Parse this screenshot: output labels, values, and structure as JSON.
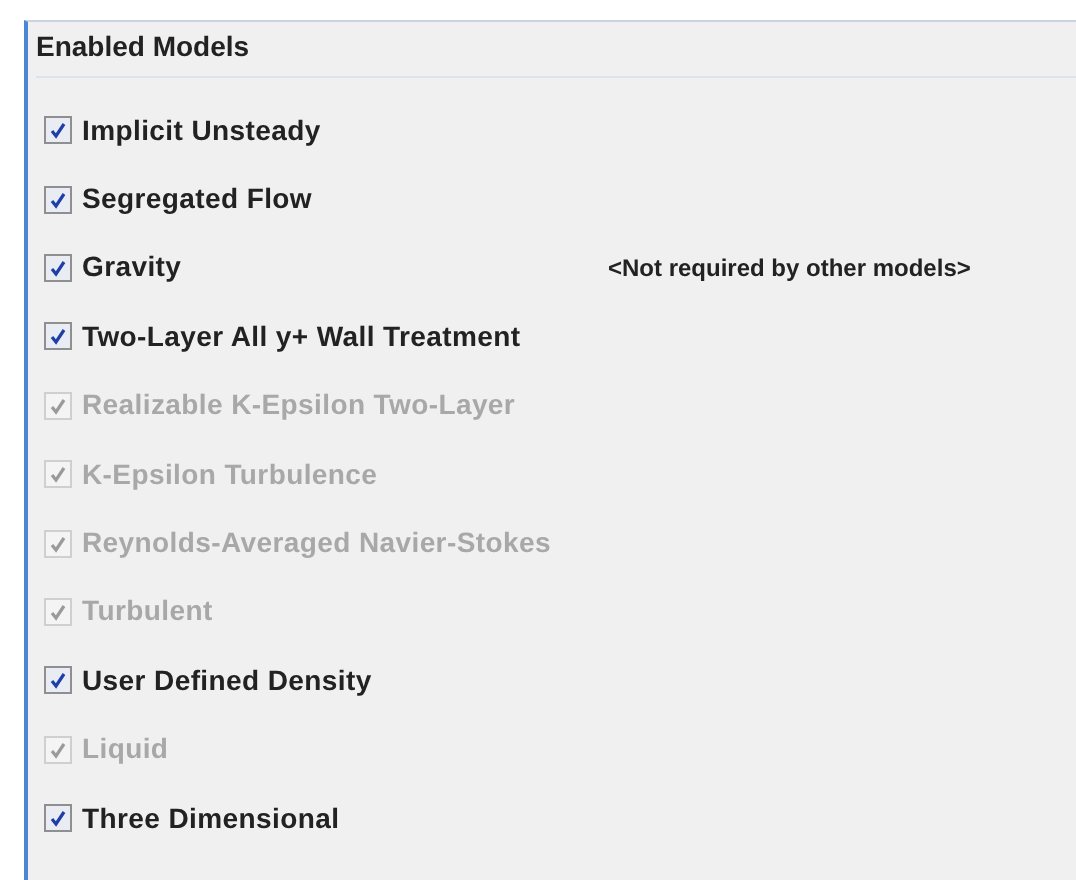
{
  "panel": {
    "title": "Enabled Models",
    "models": [
      {
        "label": "Implicit Unsteady",
        "checked": true,
        "disabled": false
      },
      {
        "label": "Segregated Flow",
        "checked": true,
        "disabled": false
      },
      {
        "label": "Gravity",
        "checked": true,
        "disabled": false,
        "note": "<Not required by other models>"
      },
      {
        "label": "Two-Layer All y+ Wall Treatment",
        "checked": true,
        "disabled": false
      },
      {
        "label": "Realizable K-Epsilon Two-Layer",
        "checked": true,
        "disabled": true
      },
      {
        "label": "K-Epsilon Turbulence",
        "checked": true,
        "disabled": true
      },
      {
        "label": "Reynolds-Averaged Navier-Stokes",
        "checked": true,
        "disabled": true
      },
      {
        "label": "Turbulent",
        "checked": true,
        "disabled": true
      },
      {
        "label": "User Defined Density",
        "checked": true,
        "disabled": false
      },
      {
        "label": "Liquid",
        "checked": true,
        "disabled": true
      },
      {
        "label": "Three Dimensional",
        "checked": true,
        "disabled": false
      }
    ]
  }
}
